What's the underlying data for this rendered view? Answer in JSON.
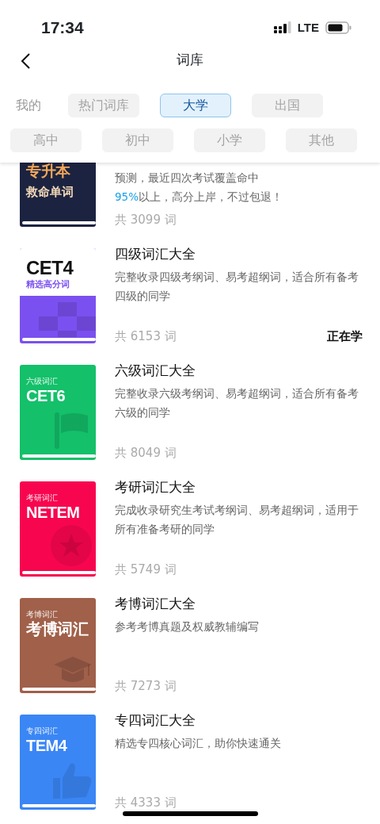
{
  "status_bar": {
    "time": "17:34",
    "network": "LTE"
  },
  "nav": {
    "title": "词库"
  },
  "tab_rows": [
    {
      "tabs": [
        {
          "label": "我的",
          "kind": "plain",
          "selected": false
        },
        {
          "label": "热门词库",
          "kind": "chip",
          "selected": false
        },
        {
          "label": "大学",
          "kind": "chip",
          "selected": true
        },
        {
          "label": "出国",
          "kind": "chip",
          "selected": false
        }
      ]
    },
    {
      "tabs": [
        {
          "label": "高中",
          "kind": "chip",
          "selected": false
        },
        {
          "label": "初中",
          "kind": "chip",
          "selected": false
        },
        {
          "label": "小学",
          "kind": "chip",
          "selected": false
        },
        {
          "label": "其他",
          "kind": "chip",
          "selected": false
        }
      ]
    }
  ],
  "books": [
    {
      "cover": {
        "kind": "navy",
        "color": "#1c2340",
        "lines": [
          {
            "text": "专升本",
            "kind": "headline"
          },
          {
            "text": "救命单词",
            "kind": "subline"
          }
        ]
      },
      "description_lines": [
        {
          "text": "预测，最近四次考试覆盖命中"
        },
        {
          "highlight": "95%",
          "text": "以上，高分上岸，不过包退！"
        }
      ],
      "count": "共 3099 词"
    },
    {
      "cover": {
        "kind": "split",
        "color": "#7b50f0",
        "lines": [
          {
            "text": "CET4",
            "kind": "headline"
          },
          {
            "text": "精选高分词",
            "kind": "subline"
          }
        ]
      },
      "title": "四级词汇大全",
      "description_lines": [
        {
          "text": "完整收录四级考纲词、易考超纲词，适合所有备考四级的同学"
        }
      ],
      "count": "共 6153 词",
      "status": "正在学"
    },
    {
      "cover": {
        "kind": "flag",
        "color": "#14c06a",
        "lines": [
          {
            "text": "六级词汇",
            "kind": "caption"
          },
          {
            "text": "CET6",
            "kind": "headline"
          }
        ]
      },
      "title": "六级词汇大全",
      "description_lines": [
        {
          "text": "完整收录六级考纲词、易考超纲词，适合所有备考六级的同学"
        }
      ],
      "count": "共 8049 词"
    },
    {
      "cover": {
        "kind": "star",
        "color": "#f7064f",
        "lines": [
          {
            "text": "考研词汇",
            "kind": "caption"
          },
          {
            "text": "NETEM",
            "kind": "headline"
          }
        ]
      },
      "title": "考研词汇大全",
      "description_lines": [
        {
          "text": "完成收录研究生考试考纲词、易考超纲词，适用于所有准备考研的同学"
        }
      ],
      "count": "共 5749 词"
    },
    {
      "cover": {
        "kind": "cap",
        "color": "#a0604a",
        "lines": [
          {
            "text": "考博词汇",
            "kind": "caption"
          },
          {
            "text": "考博词汇",
            "kind": "headline"
          }
        ]
      },
      "title": "考博词汇大全",
      "description_lines": [
        {
          "text": "参考考博真题及权威教辅编写"
        }
      ],
      "count": "共 7273 词"
    },
    {
      "cover": {
        "kind": "thumb",
        "color": "#3a86f5",
        "lines": [
          {
            "text": "专四词汇",
            "kind": "caption"
          },
          {
            "text": "TEM4",
            "kind": "headline"
          }
        ]
      },
      "title": "专四词汇大全",
      "description_lines": [
        {
          "text": "精选专四核心词汇，助你快速通关"
        }
      ],
      "count": "共 4333 词"
    }
  ]
}
